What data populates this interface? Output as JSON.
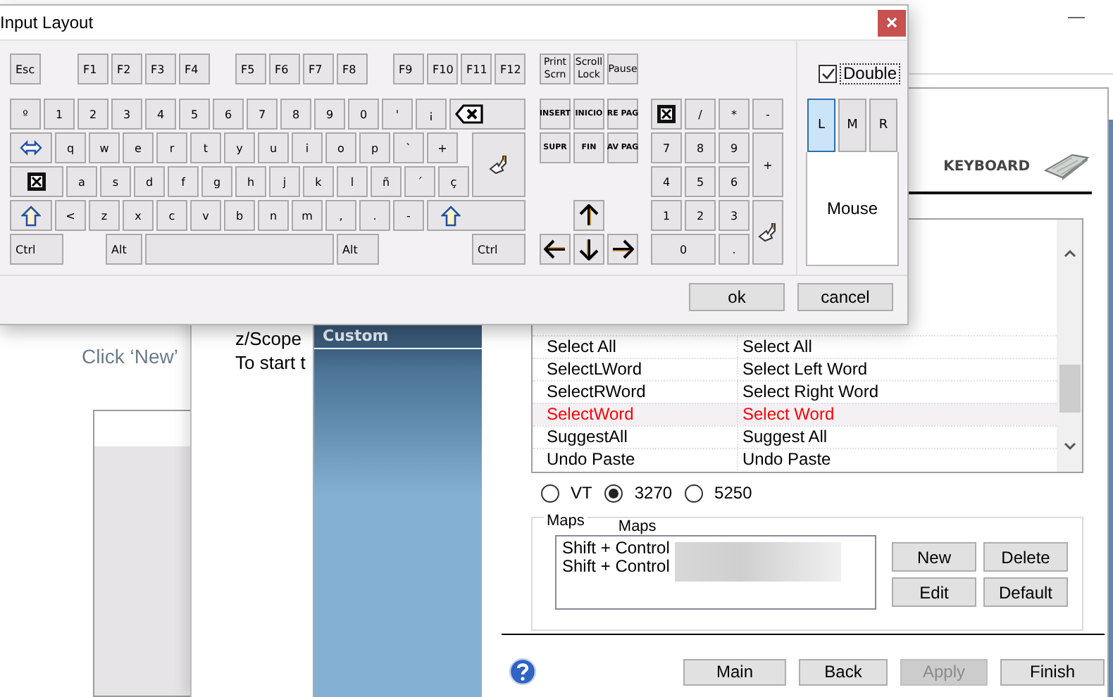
{
  "background": {
    "page_text": "Click ‘New’",
    "document_lines": [
      "z/Scope",
      "To start t"
    ]
  },
  "wizard": {
    "sidebar_header": "Custom",
    "section_title": "KEYBOARD",
    "table": {
      "rows": [
        {
          "cells": [
            "Select All",
            "Select All"
          ],
          "selected": false
        },
        {
          "cells": [
            "SelectLWord",
            "Select Left Word"
          ],
          "selected": false
        },
        {
          "cells": [
            "SelectRWord",
            "Select Right Word"
          ],
          "selected": false
        },
        {
          "cells": [
            "SelectWord",
            "Select Word"
          ],
          "selected": true
        },
        {
          "cells": [
            "SuggestAll",
            "Suggest All"
          ],
          "selected": false
        },
        {
          "cells": [
            "Undo Paste",
            "Undo Paste"
          ],
          "selected": false
        }
      ]
    },
    "terminal_types": [
      {
        "label": "VT",
        "selected": false
      },
      {
        "label": "3270",
        "selected": true
      },
      {
        "label": "5250",
        "selected": false
      }
    ],
    "maps": {
      "labels": [
        "Maps",
        "Maps"
      ],
      "items": [
        "Shift + Control",
        "Shift + Control"
      ],
      "buttons": [
        "New",
        "Delete",
        "Edit",
        "Default"
      ]
    },
    "footer_buttons": [
      {
        "label": "Main",
        "disabled": false
      },
      {
        "label": "Back",
        "disabled": false
      },
      {
        "label": "Apply",
        "disabled": true
      },
      {
        "label": "Finish",
        "disabled": false
      }
    ]
  },
  "dialog": {
    "title": "Input Layout",
    "function_keys": [
      [
        "Esc"
      ],
      [
        "F1",
        "F2",
        "F3",
        "F4"
      ],
      [
        "F5",
        "F6",
        "F7",
        "F8"
      ],
      [
        "F9",
        "F10",
        "F11",
        "F12"
      ]
    ],
    "system_keys": [
      "Print Scrn",
      "Scroll Lock",
      "Pause"
    ],
    "main_rows": [
      [
        {
          "kind": "char",
          "label": "º"
        },
        {
          "kind": "char",
          "label": "1"
        },
        {
          "kind": "char",
          "label": "2"
        },
        {
          "kind": "char",
          "label": "3"
        },
        {
          "kind": "char",
          "label": "4"
        },
        {
          "kind": "char",
          "label": "5"
        },
        {
          "kind": "char",
          "label": "6"
        },
        {
          "kind": "char",
          "label": "7"
        },
        {
          "kind": "char",
          "label": "8"
        },
        {
          "kind": "char",
          "label": "9"
        },
        {
          "kind": "char",
          "label": "0"
        },
        {
          "kind": "char",
          "label": "'"
        },
        {
          "kind": "char",
          "label": "¡"
        },
        {
          "kind": "backspace"
        }
      ],
      [
        {
          "kind": "tab"
        },
        {
          "kind": "char",
          "label": "q"
        },
        {
          "kind": "char",
          "label": "w"
        },
        {
          "kind": "char",
          "label": "e"
        },
        {
          "kind": "char",
          "label": "r"
        },
        {
          "kind": "char",
          "label": "t"
        },
        {
          "kind": "char",
          "label": "y"
        },
        {
          "kind": "char",
          "label": "u"
        },
        {
          "kind": "char",
          "label": "i"
        },
        {
          "kind": "char",
          "label": "o"
        },
        {
          "kind": "char",
          "label": "p"
        },
        {
          "kind": "char",
          "label": "`"
        },
        {
          "kind": "char",
          "label": "+"
        },
        {
          "kind": "enter"
        }
      ],
      [
        {
          "kind": "caps"
        },
        {
          "kind": "char",
          "label": "a"
        },
        {
          "kind": "char",
          "label": "s"
        },
        {
          "kind": "char",
          "label": "d"
        },
        {
          "kind": "char",
          "label": "f"
        },
        {
          "kind": "char",
          "label": "g"
        },
        {
          "kind": "char",
          "label": "h"
        },
        {
          "kind": "char",
          "label": "j"
        },
        {
          "kind": "char",
          "label": "k"
        },
        {
          "kind": "char",
          "label": "l"
        },
        {
          "kind": "char",
          "label": "ñ"
        },
        {
          "kind": "char",
          "label": "´"
        },
        {
          "kind": "char",
          "label": "ç"
        }
      ],
      [
        {
          "kind": "shift"
        },
        {
          "kind": "char",
          "label": "<"
        },
        {
          "kind": "char",
          "label": "z"
        },
        {
          "kind": "char",
          "label": "x"
        },
        {
          "kind": "char",
          "label": "c"
        },
        {
          "kind": "char",
          "label": "v"
        },
        {
          "kind": "char",
          "label": "b"
        },
        {
          "kind": "char",
          "label": "n"
        },
        {
          "kind": "char",
          "label": "m"
        },
        {
          "kind": "char",
          "label": ","
        },
        {
          "kind": "char",
          "label": "."
        },
        {
          "kind": "char",
          "label": "-"
        },
        {
          "kind": "rshift"
        }
      ],
      [
        {
          "kind": "lctrl",
          "label": "Ctrl"
        },
        {
          "kind": "alt",
          "label": "Alt"
        },
        {
          "kind": "space"
        },
        {
          "kind": "altgr",
          "label": "Alt"
        },
        {
          "kind": "rctrl",
          "label": "Ctrl"
        }
      ]
    ],
    "nav_keys": [
      [
        "INSERT",
        "INICIO",
        "RE PAG"
      ],
      [
        "SUPR",
        "FIN",
        "AV PAG"
      ]
    ],
    "arrow_keys": [
      [
        {
          "kind": "up"
        }
      ],
      [
        {
          "kind": "left"
        },
        {
          "kind": "down"
        },
        {
          "kind": "right"
        }
      ]
    ],
    "numpad_rows": [
      [
        {
          "kind": "numlock"
        },
        {
          "kind": "char",
          "label": "/"
        },
        {
          "kind": "char",
          "label": "*"
        },
        {
          "kind": "char",
          "label": "-"
        }
      ],
      [
        {
          "kind": "char",
          "label": "7"
        },
        {
          "kind": "char",
          "label": "8"
        },
        {
          "kind": "char",
          "label": "9"
        },
        {
          "kind": "tall",
          "label": "+"
        }
      ],
      [
        {
          "kind": "char",
          "label": "4"
        },
        {
          "kind": "char",
          "label": "5"
        },
        {
          "kind": "char",
          "label": "6"
        }
      ],
      [
        {
          "kind": "char",
          "label": "1"
        },
        {
          "kind": "char",
          "label": "2"
        },
        {
          "kind": "char",
          "label": "3"
        },
        {
          "kind": "numenter"
        }
      ],
      [
        {
          "kind": "wide",
          "label": "0"
        },
        {
          "kind": "char",
          "label": "."
        }
      ]
    ],
    "double": {
      "label": "Double",
      "checked": true
    },
    "mouse_buttons": [
      {
        "label": "L",
        "selected": true
      },
      {
        "label": "M",
        "selected": false
      },
      {
        "label": "R",
        "selected": false
      }
    ],
    "mouse_label": "Mouse",
    "buttons": [
      "ok",
      "cancel"
    ]
  }
}
